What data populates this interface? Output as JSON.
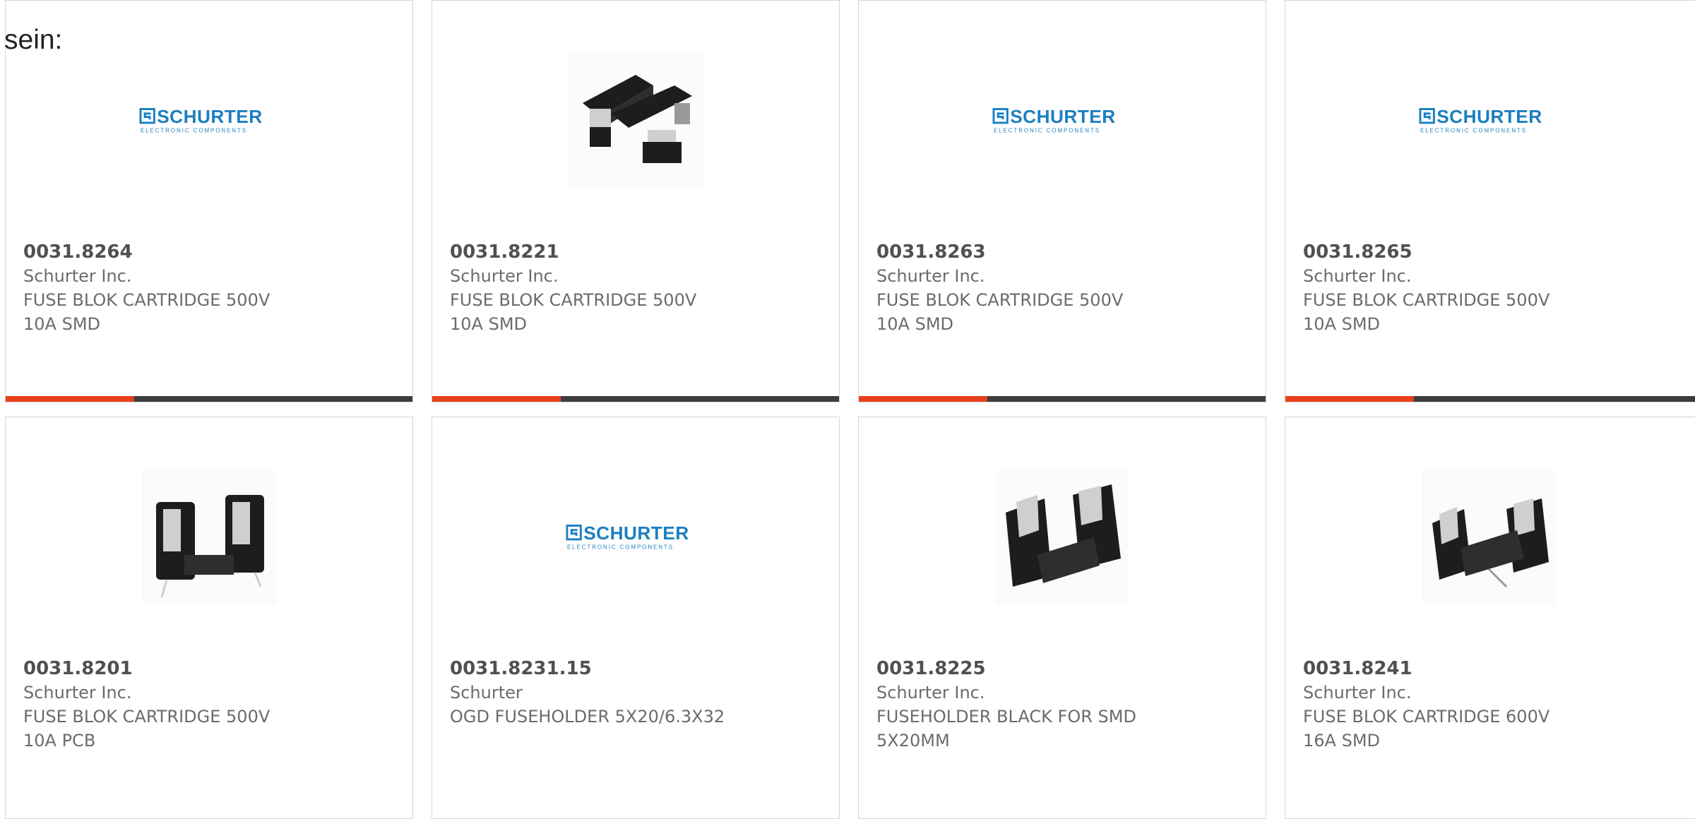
{
  "intro_text": "sein:",
  "colors": {
    "accent": "#e8401c",
    "bar": "#3c3c3c",
    "schurter_blue": "#1b7fc0"
  },
  "logo": {
    "brand": "SCHURTER",
    "tagline": "ELECTRONIC COMPONENTS"
  },
  "products": [
    {
      "part_number": "0031.8264",
      "manufacturer": "Schurter Inc.",
      "description": "FUSE BLOK CARTRIDGE 500V\n10A SMD",
      "image": "schurter-logo"
    },
    {
      "part_number": "0031.8221",
      "manufacturer": "Schurter Inc.",
      "description": "FUSE BLOK CARTRIDGE 500V\n10A SMD",
      "image": "fuse-block-photo"
    },
    {
      "part_number": "0031.8263",
      "manufacturer": "Schurter Inc.",
      "description": "FUSE BLOK CARTRIDGE 500V\n10A SMD",
      "image": "schurter-logo"
    },
    {
      "part_number": "0031.8265",
      "manufacturer": "Schurter Inc.",
      "description": "FUSE BLOK CARTRIDGE 500V\n10A SMD",
      "image": "schurter-logo"
    },
    {
      "part_number": "0031.8201",
      "manufacturer": "Schurter Inc.",
      "description": "FUSE BLOK CARTRIDGE 500V\n10A PCB",
      "image": "fuse-block-photo"
    },
    {
      "part_number": "0031.8231.15",
      "manufacturer": "Schurter",
      "description": "OGD FUSEHOLDER 5X20/6.3X32",
      "image": "schurter-logo"
    },
    {
      "part_number": "0031.8225",
      "manufacturer": "Schurter Inc.",
      "description": "FUSEHOLDER BLACK FOR SMD\n5X20MM",
      "image": "fuse-block-photo"
    },
    {
      "part_number": "0031.8241",
      "manufacturer": "Schurter Inc.",
      "description": "FUSE BLOK CARTRIDGE 600V\n16A SMD",
      "image": "fuse-block-photo"
    }
  ]
}
